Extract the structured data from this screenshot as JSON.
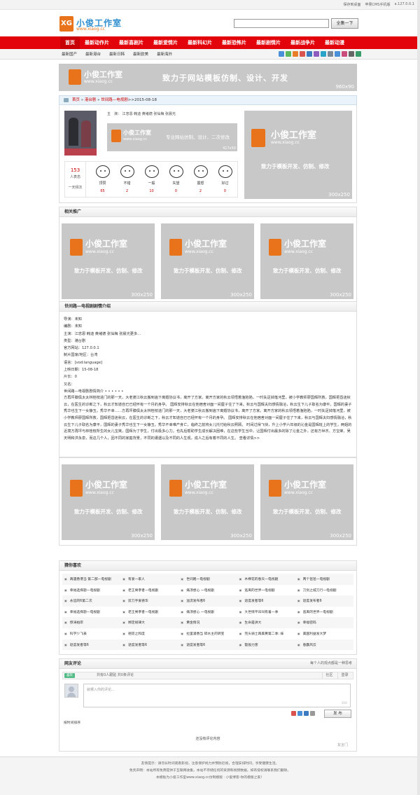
{
  "topbar": {
    "links": [
      "保存到桌面",
      "苹果CMS手机版",
      "a.127.0.0.1"
    ]
  },
  "header": {
    "logo_mark": "XG",
    "logo_text": "小俊工作室",
    "logo_sub": "www.xiaog.cc",
    "search_placeholder": "",
    "search_button": "全集一下"
  },
  "nav": {
    "items": [
      "首页",
      "最新动作片",
      "最新喜剧片",
      "最新爱情片",
      "最新科幻片",
      "最新恐怖片",
      "最新剧情片",
      "最新战争片",
      "最新动漫"
    ]
  },
  "subnav": {
    "items": [
      "最新国产",
      "最新港台",
      "最新日韩",
      "最新欧美",
      "最新海外"
    ]
  },
  "banner": {
    "logo_text": "小俊工作室",
    "url": "www.xiaog.cc",
    "slogan": "致力于网站模板仿制、设计、开发",
    "size": "960x90"
  },
  "breadcrumb": {
    "home": "首页",
    "sep1": "»",
    "cat": "港台剧",
    "sep2": "»",
    "title": "世间路—电视剧",
    "date": ">>2015-08-18"
  },
  "info": {
    "actors": "主　演：  江忠恩  韩迪  黄绪德  张仙梅  张晨光",
    "ad": {
      "logo_text": "小俊工作室",
      "url": "www.xiaog.cc",
      "slogan": "专业网站仿制、设计、二次修改",
      "size": "417x50"
    }
  },
  "vote": {
    "count": "153",
    "count_label": "人表态",
    "period": "一天拜次",
    "faces": [
      {
        "label": "顶赞",
        "value": "65"
      },
      {
        "label": "不错",
        "value": "2"
      },
      {
        "label": "一般",
        "value": "10"
      },
      {
        "label": "失望",
        "value": "0"
      },
      {
        "label": "震怒",
        "value": "2"
      },
      {
        "label": "好过",
        "value": "0"
      }
    ]
  },
  "sidead": {
    "logo_text": "小俊工作室",
    "url": "www.xiaog.cc",
    "slogan": "致力于模板开发、仿制、修改",
    "size": "300x250"
  },
  "related": {
    "title": "相关推广"
  },
  "box": {
    "logo_text": "小俊工作室",
    "url": "www.xiaog.cc",
    "slogan": "致力于模板开发、仿制、修改",
    "size": "300x250"
  },
  "plot": {
    "title": "世间路—电视剧剧情介绍",
    "lines": [
      "导演：未知",
      "编剧：未知",
      "主演：江忠恩  韩迪  黄绪德  张仙梅  张晨光更多...",
      "类型：港台剧",
      "官方网站：127.0.0.1",
      "制片国家/地区：台湾",
      "语言：[vod:language]",
      "上映日期：15-08-18",
      "片长：0",
      "又名："
    ],
    "desc_title": "世间路—电视剧剧情简介  •  •  •  •  •  •",
    "desc": "方再坪膝俱太太林桂枝进门的那一天，大老婆江秋云搬到庙下离婚协议书，离开了方家。离开方家的秋云领悟着渔陷陷，一时失足掉落河里，被小学教师廖国辉所救，国辉把昏迷秋云，在医生的诊断之下，秋云才知道自已已经怀有一个月的身孕。  国辉安排秋云在他宿舍对面一间屋子住了下来。秋云与国辉夫妇感情融洽，秋云生下儿子取名为康平。国辉的妻子秀华也生下一女静玉。秀华不幸……方再坪膝俱太太林桂枝进门的那一天，大老婆江秋云搬到庙下离婚协议书，离开了方家。离开方家的秋云领悟着渔陷陷，一时失足掉落河里，被小学教师廖国辉所救，国辉把昏迷秋云，在医生的诊断之下，秋云才知道自已已经怀有一个月的身孕。  国辉安排秋云在他宿舍对面一间屋子住了下来，秋云与国辉夫妇感情融洽，秋云生下儿子取名为康平，国辉的妻子秀华也生下一女静玉。秀华不幸难产身亡，临终之前将女儿托付给秋云照顾。  时间过得飞快，升上小学六年级的沁金是国辉班上的学生，两姐的近境方再坪与林桂枝所生的女儿宝爽，国辉为了学生，付出极多心力。也先后帮助学生成长解决困难，在这些学生当中，让国辉付出最多的除了沁金之外，还有方世杰、方宝荣、吴天明和洪永泉，而这几个人，因不同的家庭背景，不同的遭遇以及不同的人生观，成人之后有着不同的人生。  查看详情>>"
  },
  "likes": {
    "title": "猜你喜欢",
    "rows": [
      [
        "再遇香港当 第二部—电视剧",
        "有爱一家人",
        "世间路—电视剧",
        "木棉花的春天—电视剧",
        "两个爸爸—电视剧"
      ],
      [
        "幸福选择题—电视剧",
        "老王男孝者—电视剧",
        "痛须想心 一电视剧",
        "逃离的世界—电视剧",
        "刀剑之城刀行—电视剧"
      ],
      [
        "永远的6第二次",
        "剪刀手爱德华",
        "溢流发布者6",
        "退度发者等6",
        "退度发布者6"
      ],
      [
        "幸福选择题—电视剧",
        "老王男孝者—电视剧",
        "痛须想心 一电视剧",
        "大世情平凹叫有着—季",
        "逃离的世界—电视剧"
      ],
      [
        "惊涛拍岸",
        "绑定规律大",
        "黄金情况",
        "生命是讲大",
        "幸福密码"
      ],
      [
        "科学少飞表",
        "德昂之和度",
        "拉里灌香当 碎水主的转变",
        "完头骑士再美黄第二季: 妹",
        "美国利益发大梦"
      ],
      [
        "退度发者等6",
        "退度发者等6",
        "退度发者等6",
        "蹩般力害",
        "春霸风云"
      ]
    ]
  },
  "comments": {
    "title": "网友评论",
    "hint": "每个人的观点都是一种思考",
    "like": "喜欢",
    "stats": "共有0人跟贴 共0条评论",
    "tab1": "社区",
    "tab2": "登录",
    "placeholder": "就哪入你的评论...",
    "counter": "300",
    "post": "发 布",
    "sort": "按时间排序",
    "empty": "还没有评论内容",
    "powered": "友言门"
  },
  "footer": {
    "lines": [
      "友情提示：请勿长时间观看影视，注意保护视力并预防近视，合理安排时间，享受健康生活。",
      "免责声明：本站所有免费提供于互联网收集，本站不存储任何的资源和视频数据，如有侵权请联系我们删除。",
      "本模板为小俊工作室www.xiaog.cc仿制模版 · 小俊博客-你的模版之家！"
    ]
  },
  "colors": {
    "nav": "#e2040a",
    "accent": "#e8731a",
    "ad_bg": "#c8c8c8"
  }
}
